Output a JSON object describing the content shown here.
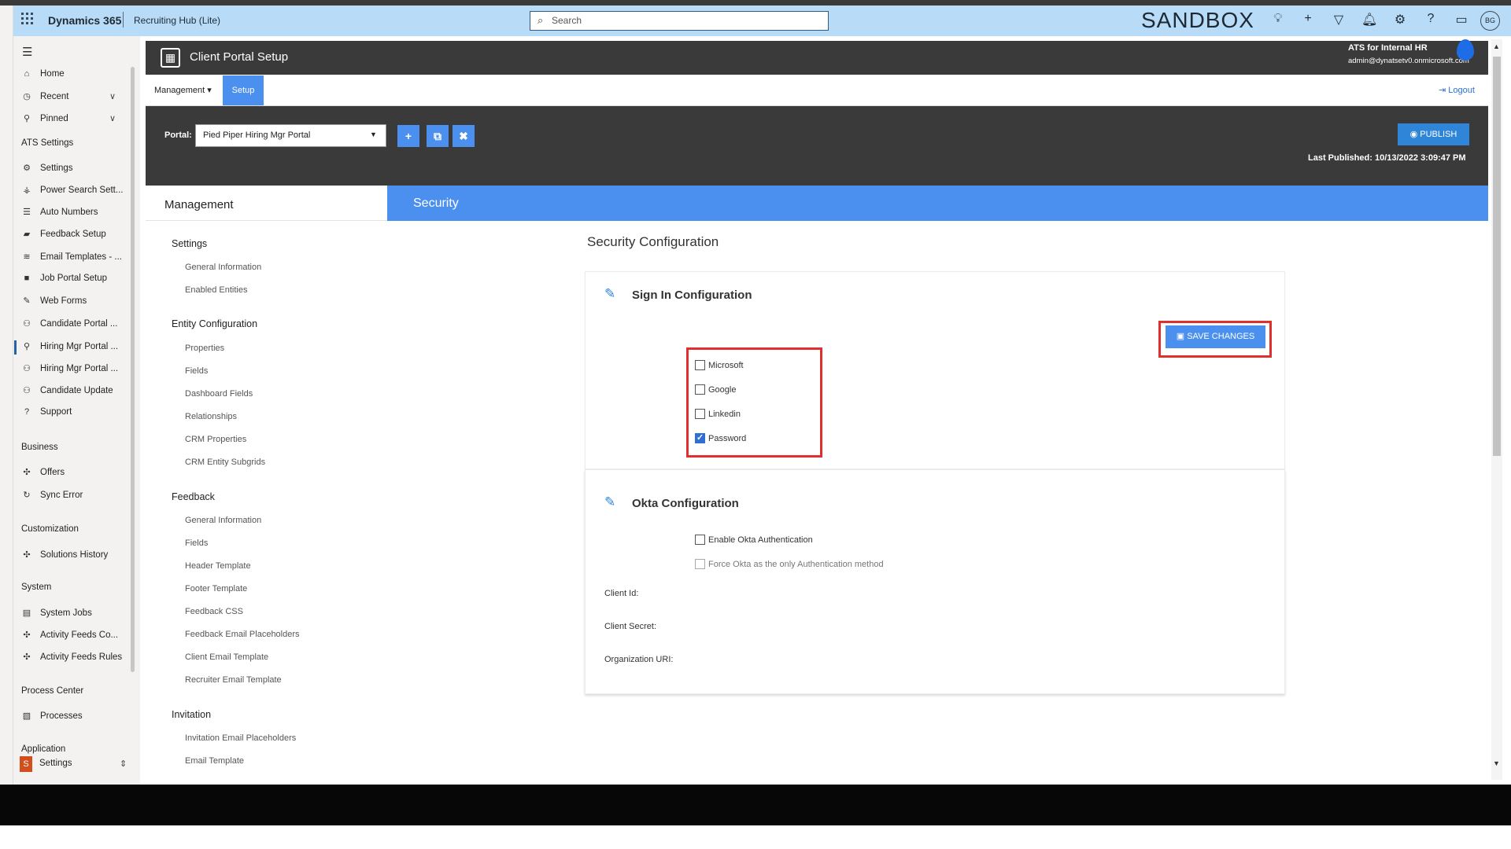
{
  "topbar": {
    "app_name": "Dynamics 365",
    "area_name": "Recruiting Hub (Lite)",
    "search_placeholder": "Search",
    "environment": "SANDBOX",
    "avatar_initials": "BG"
  },
  "leftnav": {
    "items_top": [
      {
        "label": "Home",
        "icon": "home-icon"
      },
      {
        "label": "Recent",
        "icon": "clock-icon"
      },
      {
        "label": "Pinned",
        "icon": "pin-icon"
      }
    ],
    "section_ats": "ATS Settings",
    "items_ats": [
      {
        "label": "Settings",
        "icon": "gear-icon"
      },
      {
        "label": "Power Search Sett...",
        "icon": "search-settings-icon"
      },
      {
        "label": "Auto Numbers",
        "icon": "list-icon"
      },
      {
        "label": "Feedback Setup",
        "icon": "feedback-icon"
      },
      {
        "label": "Email Templates - ...",
        "icon": "email-icon"
      },
      {
        "label": "Job Portal Setup",
        "icon": "briefcase-icon"
      },
      {
        "label": "Web Forms",
        "icon": "form-icon"
      },
      {
        "label": "Candidate Portal ...",
        "icon": "people-icon"
      },
      {
        "label": "Hiring Mgr Portal ...",
        "icon": "person-icon"
      },
      {
        "label": "Hiring Mgr Portal ...",
        "icon": "people-icon"
      },
      {
        "label": "Candidate Update",
        "icon": "people-icon"
      },
      {
        "label": "Support",
        "icon": "help-icon"
      }
    ],
    "section_business": "Business",
    "items_business": [
      {
        "label": "Offers",
        "icon": "puzzle-icon"
      },
      {
        "label": "Sync Error",
        "icon": "sync-icon"
      }
    ],
    "section_customization": "Customization",
    "items_customization": [
      {
        "label": "Solutions History",
        "icon": "puzzle-icon"
      }
    ],
    "section_system": "System",
    "items_system": [
      {
        "label": "System Jobs",
        "icon": "jobs-icon"
      },
      {
        "label": "Activity Feeds Co...",
        "icon": "puzzle-icon"
      },
      {
        "label": "Activity Feeds Rules",
        "icon": "puzzle-icon"
      }
    ],
    "section_process": "Process Center",
    "items_process": [
      {
        "label": "Processes",
        "icon": "process-icon"
      }
    ],
    "section_application": "Application",
    "app_switcher": {
      "badge": "S",
      "label": "Settings"
    }
  },
  "portal_header": {
    "title": "Client Portal Setup",
    "org": "ATS for Internal HR",
    "email": "admin@dynatsetv0.onmicrosoft.com"
  },
  "nav_row": {
    "management": "Management ▾",
    "setup": "Setup",
    "logout": "Logout"
  },
  "toolbar": {
    "portal_label": "Portal:",
    "portal_value": "Pied Piper Hiring Mgr Portal",
    "publish": "PUBLISH",
    "last_published": "Last Published: 10/13/2022 3:09:47 PM"
  },
  "side_menu": {
    "header": "Management",
    "sections": [
      {
        "title": "Settings",
        "items": [
          "General Information",
          "Enabled Entities"
        ]
      },
      {
        "title": "Entity Configuration",
        "items": [
          "Properties",
          "Fields",
          "Dashboard Fields",
          "Relationships",
          "CRM Properties",
          "CRM Entity Subgrids"
        ]
      },
      {
        "title": "Feedback",
        "items": [
          "General Information",
          "Fields",
          "Header Template",
          "Footer Template",
          "Feedback CSS",
          "Feedback Email Placeholders",
          "Client Email Template",
          "Recruiter Email Template"
        ]
      },
      {
        "title": "Invitation",
        "items": [
          "Invitation Email Placeholders",
          "Email Template"
        ]
      }
    ]
  },
  "security": {
    "band_title": "Security",
    "config_title": "Security Configuration",
    "signin": {
      "title": "Sign In Configuration",
      "save": "SAVE CHANGES",
      "options": [
        {
          "label": "Microsoft",
          "checked": false
        },
        {
          "label": "Google",
          "checked": false
        },
        {
          "label": "Linkedin",
          "checked": false
        },
        {
          "label": "Password",
          "checked": true
        }
      ]
    },
    "okta": {
      "title": "Okta Configuration",
      "enable": "Enable Okta Authentication",
      "force": "Force Okta as the only Authentication method",
      "client_id": "Client Id:",
      "client_secret": "Client Secret:",
      "org_uri": "Organization URI:"
    }
  }
}
